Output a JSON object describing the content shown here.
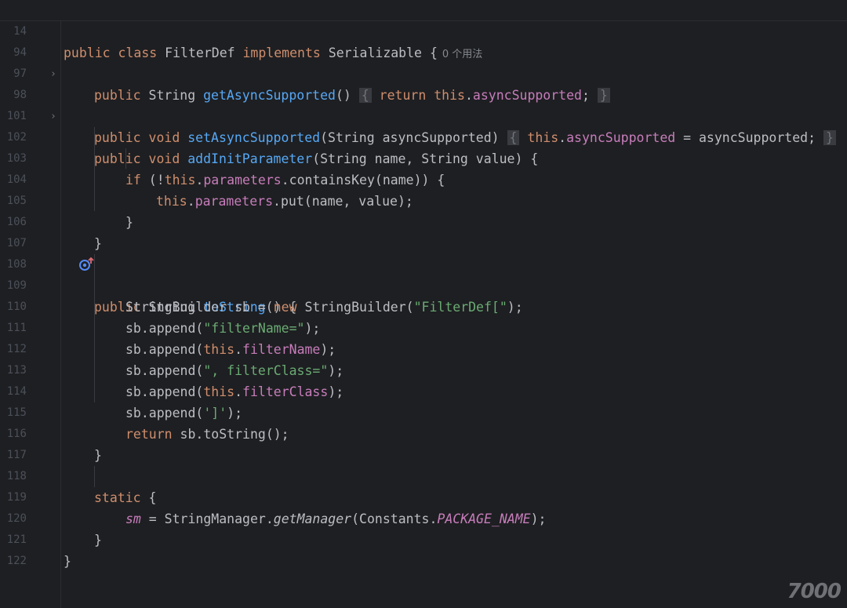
{
  "header": {
    "line_number": "14",
    "kw_public": "public",
    "kw_class": "class",
    "class_name": "FilterDef",
    "kw_implements": "implements",
    "interface_name": "Serializable",
    "brace": "{",
    "usage_hint": "0 个用法"
  },
  "lines": {
    "l94": {
      "n": "94",
      "t1": "public",
      "t2": " String ",
      "fn": "getAsyncSupported",
      "t3": "()",
      "b1": "{",
      "kw_ret": "return",
      "kw_this": "this",
      "dot": ".",
      "fld": "asyncSupported",
      "semi": ";",
      "b2": "}"
    },
    "l97": {
      "n": "97"
    },
    "l98": {
      "n": "98",
      "t1": "public",
      "t2": "void",
      "fn": "setAsyncSupported",
      "t3": "(String asyncSupported)",
      "b1": "{",
      "kw_this": "this",
      "dot": ".",
      "fld": "asyncSupported",
      "t4": " = asyncSupported;",
      "b2": "}"
    },
    "l101": {
      "n": "101"
    },
    "l102": {
      "n": "102",
      "t1": "public",
      "t2": "void",
      "fn": "addInitParameter",
      "t3": "(String name, String value) {"
    },
    "l103": {
      "n": "103",
      "kw_if": "if",
      "t1": " (!",
      "kw_this": "this",
      "dot": ".",
      "fld": "parameters",
      "t2": ".containsKey(name)) {"
    },
    "l104": {
      "n": "104",
      "kw_this": "this",
      "dot": ".",
      "fld": "parameters",
      "t2": ".put(name, value);"
    },
    "l105": {
      "n": "105",
      "t": "}"
    },
    "l106": {
      "n": "106",
      "t": "}"
    },
    "l107": {
      "n": "107"
    },
    "l108": {
      "n": "108",
      "t1": "public",
      "t2": " String ",
      "fn": "toString",
      "t3": "() {"
    },
    "l109": {
      "n": "109",
      "t1": "StringBuilder sb = ",
      "kw_new": "new",
      "t2": " StringBuilder(",
      "str": "\"FilterDef[\"",
      "t3": ");"
    },
    "l110": {
      "n": "110",
      "t1": "sb.append(",
      "str": "\"filterName=\"",
      "t3": ");"
    },
    "l111": {
      "n": "111",
      "t1": "sb.append(",
      "kw_this": "this",
      "dot": ".",
      "fld": "filterName",
      "t3": ");"
    },
    "l112": {
      "n": "112",
      "t1": "sb.append(",
      "str": "\", filterClass=\"",
      "t3": ");"
    },
    "l113": {
      "n": "113",
      "t1": "sb.append(",
      "kw_this": "this",
      "dot": ".",
      "fld": "filterClass",
      "t3": ");"
    },
    "l114": {
      "n": "114",
      "t1": "sb.append(",
      "str": "']'",
      "t3": ");"
    },
    "l115": {
      "n": "115",
      "kw_ret": "return",
      "t1": " sb.toString();"
    },
    "l116": {
      "n": "116",
      "t": "}"
    },
    "l117": {
      "n": "117"
    },
    "l118": {
      "n": "118",
      "kw_static": "static",
      "t1": " {"
    },
    "l119": {
      "n": "119",
      "fld": "sm",
      "t1": " = StringManager.",
      "fn_ital": "getManager",
      "t2": "(Constants.",
      "const": "PACKAGE_NAME",
      "t3": ");"
    },
    "l120": {
      "n": "120",
      "t": "}"
    },
    "l121": {
      "n": "121",
      "t": "}"
    },
    "l122": {
      "n": "122"
    }
  },
  "gutter": {
    "fold_arrow": "›",
    "override_icon": "override-up-icon"
  },
  "watermark": {
    "text": "7000"
  },
  "colors": {
    "background": "#1e1f22",
    "keyword": "#cf8e6d",
    "function": "#56a8f5",
    "field": "#c77dbb",
    "string": "#6aab73",
    "text": "#bcbec4",
    "line_number": "#4b5059"
  }
}
